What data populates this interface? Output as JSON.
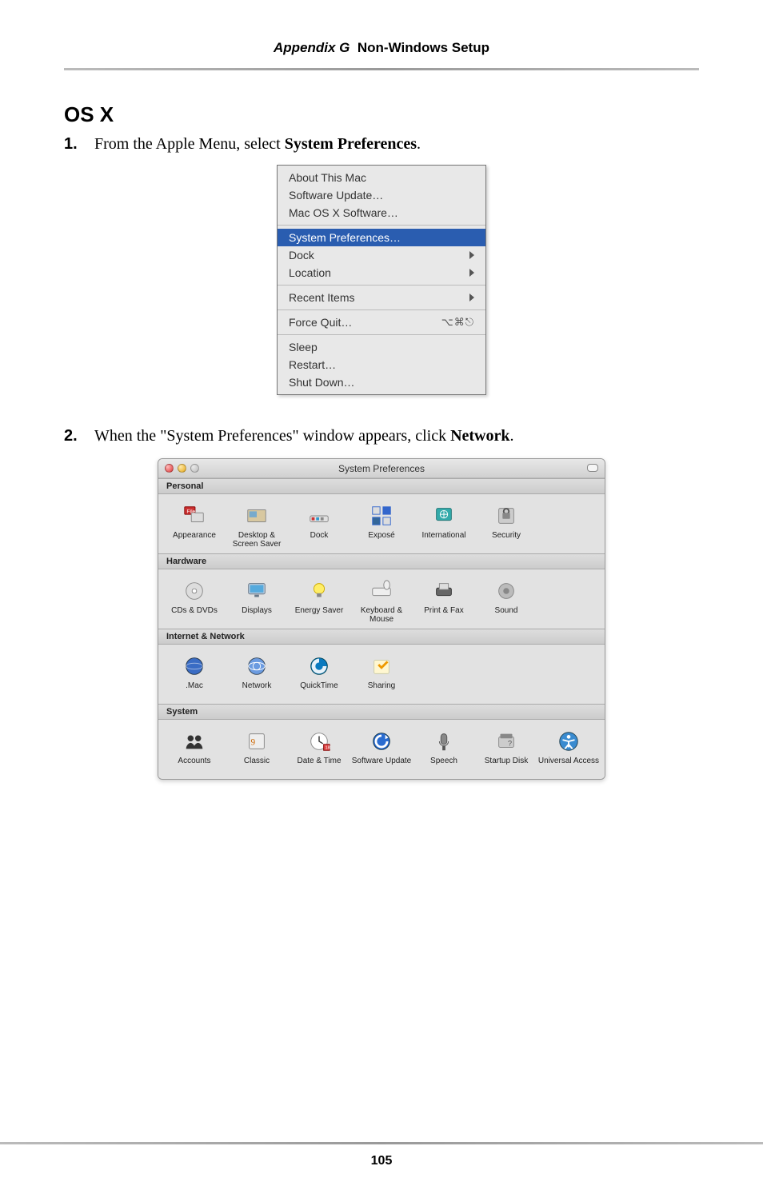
{
  "header": {
    "appendix": "Appendix G",
    "title": "Non-Windows Setup"
  },
  "heading": "OS X",
  "steps": [
    {
      "num": "1.",
      "pre": "From the Apple Menu, select ",
      "bold": "System Preferences",
      "post": "."
    },
    {
      "num": "2.",
      "pre": "When the \"System Preferences\" window appears, click ",
      "bold": "Network",
      "post": "."
    }
  ],
  "apple_menu": {
    "groups": [
      [
        {
          "label": "About This Mac",
          "selected": false,
          "submenu": false,
          "shortcut": ""
        },
        {
          "label": "Software Update…",
          "selected": false,
          "submenu": false,
          "shortcut": ""
        },
        {
          "label": "Mac OS X Software…",
          "selected": false,
          "submenu": false,
          "shortcut": ""
        }
      ],
      [
        {
          "label": "System Preferences…",
          "selected": true,
          "submenu": false,
          "shortcut": ""
        },
        {
          "label": "Dock",
          "selected": false,
          "submenu": true,
          "shortcut": ""
        },
        {
          "label": "Location",
          "selected": false,
          "submenu": true,
          "shortcut": ""
        }
      ],
      [
        {
          "label": "Recent Items",
          "selected": false,
          "submenu": true,
          "shortcut": ""
        }
      ],
      [
        {
          "label": "Force Quit…",
          "selected": false,
          "submenu": false,
          "shortcut": "⌥⌘⎋"
        }
      ],
      [
        {
          "label": "Sleep",
          "selected": false,
          "submenu": false,
          "shortcut": ""
        },
        {
          "label": "Restart…",
          "selected": false,
          "submenu": false,
          "shortcut": ""
        },
        {
          "label": "Shut Down…",
          "selected": false,
          "submenu": false,
          "shortcut": ""
        }
      ]
    ]
  },
  "sysprefs": {
    "title": "System Preferences",
    "sections": [
      {
        "name": "Personal",
        "items": [
          {
            "label": "Appearance",
            "icon": "appearance"
          },
          {
            "label": "Desktop & Screen Saver",
            "icon": "desktop"
          },
          {
            "label": "Dock",
            "icon": "dock"
          },
          {
            "label": "Exposé",
            "icon": "expose"
          },
          {
            "label": "International",
            "icon": "intl"
          },
          {
            "label": "Security",
            "icon": "security"
          }
        ]
      },
      {
        "name": "Hardware",
        "items": [
          {
            "label": "CDs & DVDs",
            "icon": "cd"
          },
          {
            "label": "Displays",
            "icon": "display"
          },
          {
            "label": "Energy Saver",
            "icon": "bulb"
          },
          {
            "label": "Keyboard & Mouse",
            "icon": "keyboard"
          },
          {
            "label": "Print & Fax",
            "icon": "printer"
          },
          {
            "label": "Sound",
            "icon": "sound"
          }
        ]
      },
      {
        "name": "Internet & Network",
        "items": [
          {
            "label": ".Mac",
            "icon": "dotmac"
          },
          {
            "label": "Network",
            "icon": "network"
          },
          {
            "label": "QuickTime",
            "icon": "quicktime"
          },
          {
            "label": "Sharing",
            "icon": "sharing"
          }
        ]
      },
      {
        "name": "System",
        "items": [
          {
            "label": "Accounts",
            "icon": "accounts"
          },
          {
            "label": "Classic",
            "icon": "classic"
          },
          {
            "label": "Date & Time",
            "icon": "datetime"
          },
          {
            "label": "Software Update",
            "icon": "swupdate"
          },
          {
            "label": "Speech",
            "icon": "speech"
          },
          {
            "label": "Startup Disk",
            "icon": "startup"
          },
          {
            "label": "Universal Access",
            "icon": "universal"
          }
        ]
      }
    ]
  },
  "footer": {
    "page": "105"
  }
}
